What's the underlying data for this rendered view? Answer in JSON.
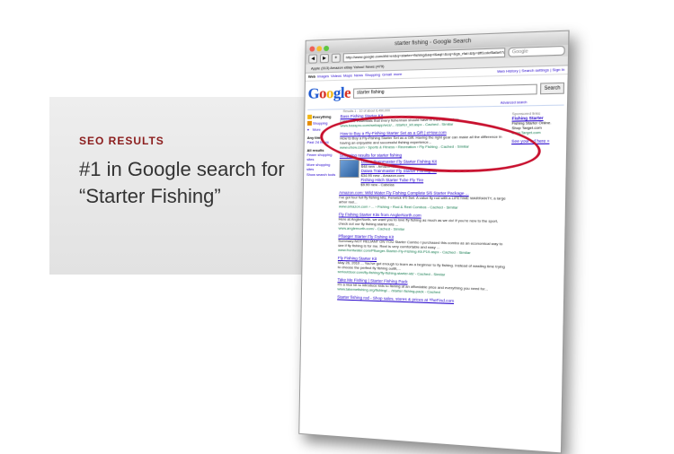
{
  "slide": {
    "kicker": "SEO RESULTS",
    "headline": "#1 in Google search for “Starter Fishing”",
    "accent_color": "#8b1d1d",
    "circle_color": "#c8102e"
  },
  "browser": {
    "title": "starter fishing - Google Search",
    "url": "http://www.google.com/#hl=en&q=starter+fishing&aq=f&aqi=&oq=&gs_rfai=&fp=8ff1cdcf5afa47c",
    "search_placeholder": "Google",
    "bookmarks": "Apple (313)   Amazon   eBay   Yahoo!   News (479)",
    "google_nav": [
      "Web",
      "Images",
      "Videos",
      "Maps",
      "News",
      "Shopping",
      "Gmail",
      "more"
    ],
    "google_right": "Web History | Search settings | Sign in",
    "query": "starter fishing",
    "search_button": "Search",
    "advanced": "Advanced search",
    "stats": "Results 1 - 10 of about 6,490,000",
    "left_nav": {
      "items": [
        "Everything",
        "Shopping",
        "More"
      ],
      "time_heading": "Any time",
      "time_items": [
        "Past 24 hours"
      ],
      "results_heading": "All results",
      "results_items": [
        "Fewer shopping sites",
        "More shopping sites"
      ],
      "options": "Show search tools"
    },
    "results": [
      {
        "title": "Bass Fishing Starter Kit",
        "snippet": "Lure - the essentials that every fisherman should have in their tackle box.",
        "url": "www.basspro.com/webapp/wcs/... /starter_kit.aspx - Cached - Similar"
      },
      {
        "title": "How to Buy a Fly-Fishing Starter Set as a Gift | eHow.com",
        "snippet": "How to Buy a Fly-Fishing Starter Set as a Gift. Having the right gear can make all the difference in having an enjoyable and successful fishing experience...",
        "url": "www.ehow.com › Sports & Fitness › Recreation › Fly Fishing - Cached - Similar"
      },
      {
        "title": "Shopping results for starter fishing",
        "snippet": "",
        "url": ""
      },
      {
        "title": "Amazon.com: Wild Water Fly Fishing Complete 5/6 Starter Package ...",
        "snippet": "I've got four full fly fishing kits. Fenwick 9'0 5wt. A value fly rod with a LIFETIME WARRANTY, a large arbor reel...",
        "url": "www.amazon.com › ... › Fishing › Rod & Reel Combos - Cached - Similar"
      },
      {
        "title": "Fly Fishing Starter Kits from AnglerNorth.com",
        "snippet": "Here at AnglerNorth, we want you to love fly fishing as much as we do! If you're new to the sport, check out our fly fishing starter kits ...",
        "url": "www.anglernorth.com/ - Cached - Similar"
      },
      {
        "title": "Pflueger Starter Fly Fishing Kit",
        "snippet": "Summary:NOT RELIANT ON YOU Starter Combo I purchased this combo as an economical way to see if fly fishing is for me. Reel is very comfortable and easy ...",
        "url": "www.frontwater.com/Pflueger-Starter-Fly-Fishing-Kit.P19.aspx - Cached - Similar"
      },
      {
        "title": "Fly Fishing Starter Kit",
        "snippet": "May 26, 2010 ... You've got enough to learn as a beginner to fly fishing. Instead of wasting time trying to choose the perfect fly fishing outfit,...",
        "url": "serioutdoor.com/fly-fishing/fly-fishing-starter-kit/ - Cached - Similar"
      },
      {
        "title": "Take Me Fishing | Starter Fishing Pack",
        "snippet": "It's a nice kit to introduce kids to fishing at an affordable price and everything you need for...",
        "url": "www.takemefishing.org/fishing/... /starter-fishing-pack - Cached"
      },
      {
        "title": "Starter fishing rod - Shop sales, stores & prices at TheFind.com",
        "snippet": "",
        "url": ""
      }
    ],
    "shopping": [
      {
        "title": "Daiwa Trainmaster Fly Starter Fishing Kit",
        "price": "$48 new - Amazon.com"
      },
      {
        "title": "Daiwa Trainmaster Fly Starter Fishing Kit",
        "price": "$34.95 new - Amazon.com"
      },
      {
        "title": "Fishing Hitch Starter Tube Fly Tire",
        "price": "$9.99 new - Cabelas"
      }
    ],
    "sponsored": {
      "heading": "Sponsored links",
      "title": "Fishing Starter",
      "line1": "Fishing Starter Online.",
      "line2": "Shop Target.com",
      "url": "www.Target.com",
      "more": "See your ad here »"
    }
  }
}
